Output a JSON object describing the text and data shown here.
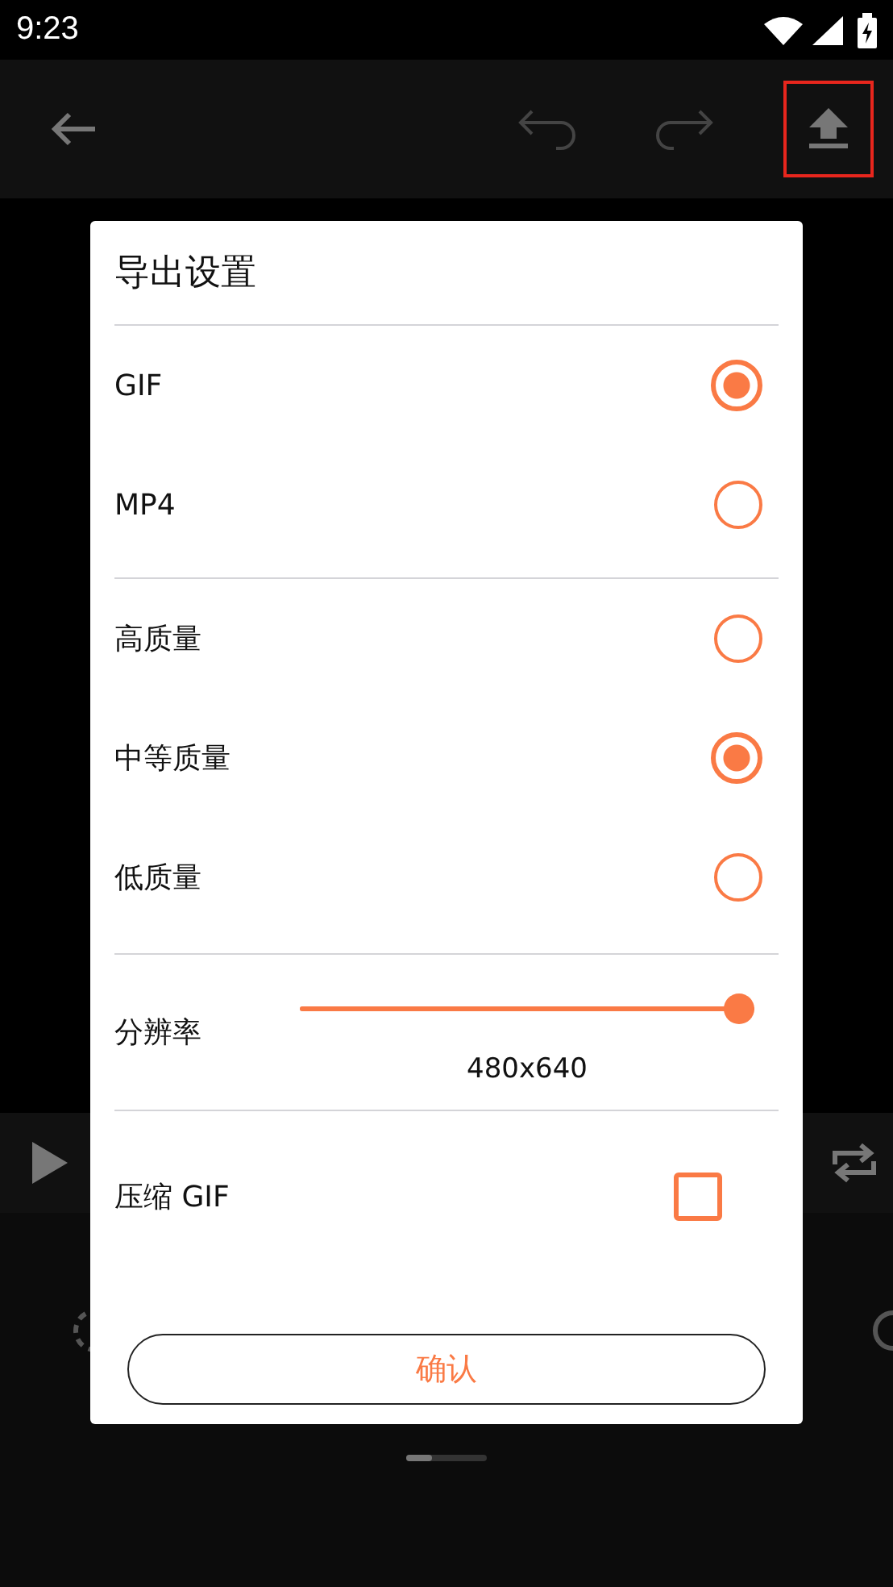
{
  "status_bar": {
    "time": "9:23"
  },
  "dialog": {
    "title": "导出设置",
    "format_options": [
      {
        "label": "GIF",
        "selected": true
      },
      {
        "label": "MP4",
        "selected": false
      }
    ],
    "quality_options": [
      {
        "label": "高质量",
        "selected": false
      },
      {
        "label": "中等质量",
        "selected": true
      },
      {
        "label": "低质量",
        "selected": false
      }
    ],
    "resolution": {
      "label": "分辨率",
      "level": 1,
      "reading": "480x640"
    },
    "compress": {
      "label": "压缩 GIF",
      "checked": false
    },
    "confirm_button": "确认"
  }
}
